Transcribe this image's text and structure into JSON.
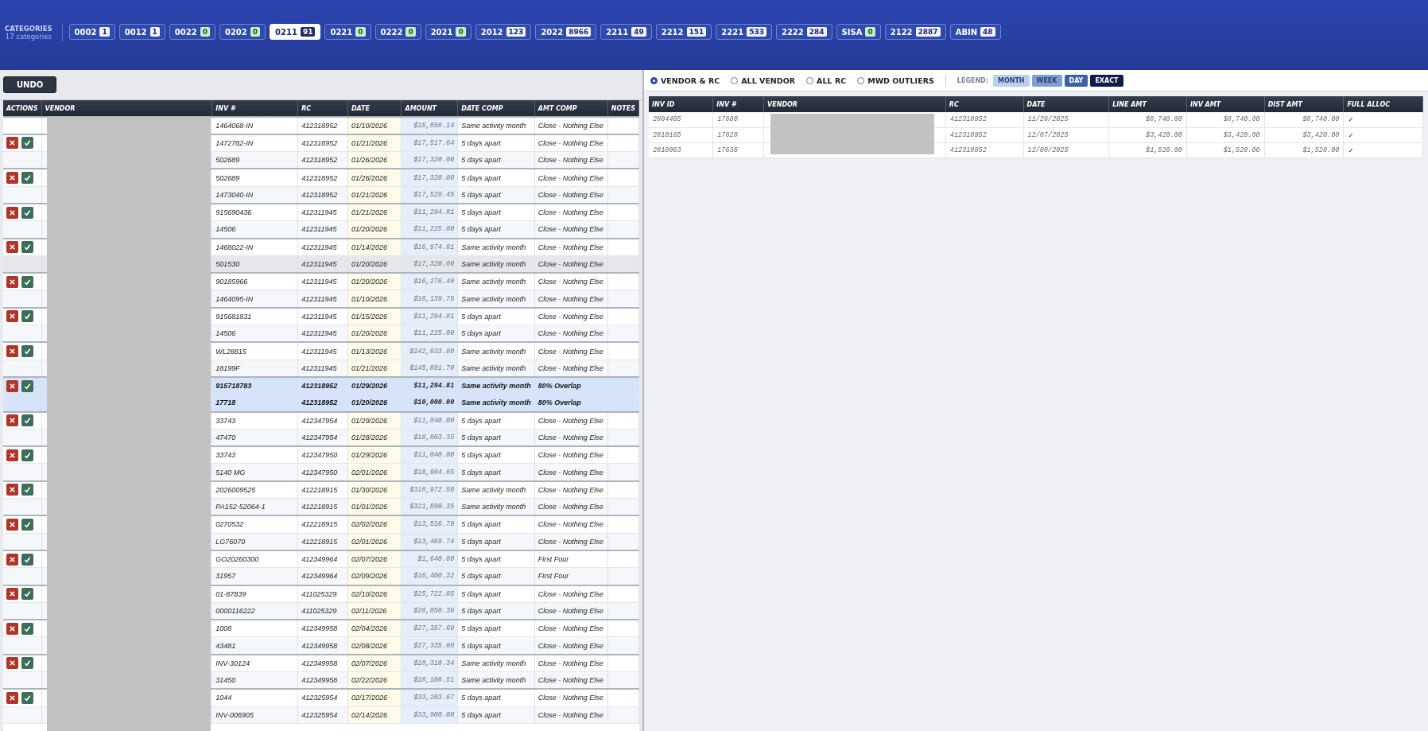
{
  "categories_panel": {
    "title": "CATEGORIES",
    "subtitle": "17 categories"
  },
  "categories": [
    {
      "code": "0002",
      "count": "1",
      "selected": false,
      "zero": false
    },
    {
      "code": "0012",
      "count": "1",
      "selected": false,
      "zero": false
    },
    {
      "code": "0022",
      "count": "0",
      "selected": false,
      "zero": true
    },
    {
      "code": "0202",
      "count": "0",
      "selected": false,
      "zero": true
    },
    {
      "code": "0211",
      "count": "91",
      "selected": true,
      "zero": false
    },
    {
      "code": "0221",
      "count": "0",
      "selected": false,
      "zero": true
    },
    {
      "code": "0222",
      "count": "0",
      "selected": false,
      "zero": true
    },
    {
      "code": "2021",
      "count": "0",
      "selected": false,
      "zero": true
    },
    {
      "code": "2012",
      "count": "123",
      "selected": false,
      "zero": false
    },
    {
      "code": "2022",
      "count": "8966",
      "selected": false,
      "zero": false
    },
    {
      "code": "2211",
      "count": "49",
      "selected": false,
      "zero": false
    },
    {
      "code": "2212",
      "count": "151",
      "selected": false,
      "zero": false
    },
    {
      "code": "2221",
      "count": "533",
      "selected": false,
      "zero": false
    },
    {
      "code": "2222",
      "count": "284",
      "selected": false,
      "zero": false
    },
    {
      "code": "SISA",
      "count": "0",
      "selected": false,
      "zero": true
    },
    {
      "code": "2122",
      "count": "2887",
      "selected": false,
      "zero": false
    },
    {
      "code": "ABIN",
      "count": "48",
      "selected": false,
      "zero": false
    }
  ],
  "undo_button": "UNDO",
  "match_table": {
    "columns": [
      "ACTIONS",
      "VENDOR",
      "INV #",
      "RC",
      "DATE",
      "AMOUNT",
      "DATE COMP",
      "AMT COMP",
      "NOTES"
    ],
    "pairs": [
      {
        "selected": false,
        "rows": [
          {
            "actions": false,
            "hovered": false,
            "inv": "1464068-IN",
            "rc": "412318952",
            "date": "01/10/2026",
            "amount": "$15,858.14",
            "date_comp": "Same activity month",
            "amt_comp": "Close - Nothing Else"
          }
        ]
      },
      {
        "selected": false,
        "rows": [
          {
            "actions": true,
            "hovered": false,
            "inv": "1472782-IN",
            "rc": "412318952",
            "date": "01/21/2026",
            "amount": "$17,517.64",
            "date_comp": "5 days apart",
            "amt_comp": "Close - Nothing Else"
          },
          {
            "actions": false,
            "hovered": false,
            "inv": "502689",
            "rc": "412318952",
            "date": "01/26/2026",
            "amount": "$17,320.00",
            "date_comp": "5 days apart",
            "amt_comp": "Close - Nothing Else"
          }
        ]
      },
      {
        "selected": false,
        "rows": [
          {
            "actions": true,
            "hovered": false,
            "inv": "502689",
            "rc": "412318952",
            "date": "01/26/2026",
            "amount": "$17,320.00",
            "date_comp": "5 days apart",
            "amt_comp": "Close - Nothing Else"
          },
          {
            "actions": false,
            "hovered": false,
            "inv": "1473040-IN",
            "rc": "412318952",
            "date": "01/21/2026",
            "amount": "$17,529.45",
            "date_comp": "5 days apart",
            "amt_comp": "Close - Nothing Else"
          }
        ]
      },
      {
        "selected": false,
        "rows": [
          {
            "actions": true,
            "hovered": false,
            "inv": "915690436",
            "rc": "412311945",
            "date": "01/21/2026",
            "amount": "$11,294.81",
            "date_comp": "5 days apart",
            "amt_comp": "Close - Nothing Else"
          },
          {
            "actions": false,
            "hovered": false,
            "inv": "14506",
            "rc": "412311945",
            "date": "01/20/2026",
            "amount": "$11,225.00",
            "date_comp": "5 days apart",
            "amt_comp": "Close - Nothing Else"
          }
        ]
      },
      {
        "selected": false,
        "rows": [
          {
            "actions": true,
            "hovered": false,
            "inv": "1468022-IN",
            "rc": "412311945",
            "date": "01/14/2026",
            "amount": "$16,974.81",
            "date_comp": "Same activity month",
            "amt_comp": "Close - Nothing Else"
          },
          {
            "actions": false,
            "hovered": true,
            "inv": "501530",
            "rc": "412311945",
            "date": "01/20/2026",
            "amount": "$17,320.00",
            "date_comp": "Same activity month",
            "amt_comp": "Close - Nothing Else"
          }
        ]
      },
      {
        "selected": false,
        "rows": [
          {
            "actions": true,
            "hovered": false,
            "inv": "90185966",
            "rc": "412311945",
            "date": "01/20/2026",
            "amount": "$16,276.40",
            "date_comp": "Same activity month",
            "amt_comp": "Close - Nothing Else"
          },
          {
            "actions": false,
            "hovered": false,
            "inv": "1464095-IN",
            "rc": "412311945",
            "date": "01/10/2026",
            "amount": "$16,139.76",
            "date_comp": "Same activity month",
            "amt_comp": "Close - Nothing Else"
          }
        ]
      },
      {
        "selected": false,
        "rows": [
          {
            "actions": true,
            "hovered": false,
            "inv": "915681831",
            "rc": "412311945",
            "date": "01/15/2026",
            "amount": "$11,294.81",
            "date_comp": "5 days apart",
            "amt_comp": "Close - Nothing Else"
          },
          {
            "actions": false,
            "hovered": false,
            "inv": "14506",
            "rc": "412311945",
            "date": "01/20/2026",
            "amount": "$11,225.00",
            "date_comp": "5 days apart",
            "amt_comp": "Close - Nothing Else"
          }
        ]
      },
      {
        "selected": false,
        "rows": [
          {
            "actions": true,
            "hovered": false,
            "inv": "WL28815",
            "rc": "412311945",
            "date": "01/13/2026",
            "amount": "$142,633.08",
            "date_comp": "Same activity month",
            "amt_comp": "Close - Nothing Else"
          },
          {
            "actions": false,
            "hovered": false,
            "inv": "18199F",
            "rc": "412311945",
            "date": "01/21/2026",
            "amount": "$145,891.70",
            "date_comp": "Same activity month",
            "amt_comp": "Close - Nothing Else"
          }
        ]
      },
      {
        "selected": true,
        "rows": [
          {
            "actions": true,
            "hovered": false,
            "inv": "915718783",
            "rc": "412318952",
            "date": "01/29/2026",
            "amount": "$11,294.81",
            "date_comp": "Same activity month",
            "amt_comp": "80% Overlap"
          },
          {
            "actions": false,
            "hovered": false,
            "inv": "17718",
            "rc": "412318952",
            "date": "01/20/2026",
            "amount": "$10,000.00",
            "date_comp": "Same activity month",
            "amt_comp": "80% Overlap"
          }
        ]
      },
      {
        "selected": false,
        "rows": [
          {
            "actions": true,
            "hovered": false,
            "inv": "33743",
            "rc": "412347954",
            "date": "01/29/2026",
            "amount": "$11,040.00",
            "date_comp": "5 days apart",
            "amt_comp": "Close - Nothing Else"
          },
          {
            "actions": false,
            "hovered": false,
            "inv": "47470",
            "rc": "412347954",
            "date": "01/28/2026",
            "amount": "$10,803.35",
            "date_comp": "5 days apart",
            "amt_comp": "Close - Nothing Else"
          }
        ]
      },
      {
        "selected": false,
        "rows": [
          {
            "actions": true,
            "hovered": false,
            "inv": "33743",
            "rc": "412347950",
            "date": "01/29/2026",
            "amount": "$11,040.00",
            "date_comp": "5 days apart",
            "amt_comp": "Close - Nothing Else"
          },
          {
            "actions": false,
            "hovered": false,
            "inv": "5140 MG",
            "rc": "412347950",
            "date": "02/01/2026",
            "amount": "$10,904.85",
            "date_comp": "5 days apart",
            "amt_comp": "Close - Nothing Else"
          }
        ]
      },
      {
        "selected": false,
        "rows": [
          {
            "actions": true,
            "hovered": false,
            "inv": "2026009525",
            "rc": "412218915",
            "date": "01/30/2026",
            "amount": "$318,972.50",
            "date_comp": "Same activity month",
            "amt_comp": "Close - Nothing Else"
          },
          {
            "actions": false,
            "hovered": false,
            "inv": "PA152-52064-1",
            "rc": "412218915",
            "date": "01/01/2026",
            "amount": "$321,890.35",
            "date_comp": "Same activity month",
            "amt_comp": "Close - Nothing Else"
          }
        ]
      },
      {
        "selected": false,
        "rows": [
          {
            "actions": true,
            "hovered": false,
            "inv": "0270532",
            "rc": "412218915",
            "date": "02/02/2026",
            "amount": "$13,516.79",
            "date_comp": "5 days apart",
            "amt_comp": "Close - Nothing Else"
          },
          {
            "actions": false,
            "hovered": false,
            "inv": "LG76070",
            "rc": "412218915",
            "date": "02/01/2026",
            "amount": "$13,469.74",
            "date_comp": "5 days apart",
            "amt_comp": "Close - Nothing Else"
          }
        ]
      },
      {
        "selected": false,
        "rows": [
          {
            "actions": true,
            "hovered": false,
            "inv": "GO20260300",
            "rc": "412349964",
            "date": "02/07/2026",
            "amount": "$1,640.00",
            "date_comp": "5 days apart",
            "amt_comp": "First Four"
          },
          {
            "actions": false,
            "hovered": false,
            "inv": "31957",
            "rc": "412349964",
            "date": "02/09/2026",
            "amount": "$16,400.32",
            "date_comp": "5 days apart",
            "amt_comp": "First Four"
          }
        ]
      },
      {
        "selected": false,
        "rows": [
          {
            "actions": true,
            "hovered": false,
            "inv": "01-87839",
            "rc": "411025329",
            "date": "02/10/2026",
            "amount": "$25,722.85",
            "date_comp": "5 days apart",
            "amt_comp": "Close - Nothing Else"
          },
          {
            "actions": false,
            "hovered": false,
            "inv": "0000116222",
            "rc": "411025329",
            "date": "02/11/2026",
            "amount": "$26,050.36",
            "date_comp": "5 days apart",
            "amt_comp": "Close - Nothing Else"
          }
        ]
      },
      {
        "selected": false,
        "rows": [
          {
            "actions": true,
            "hovered": false,
            "inv": "1008",
            "rc": "412349958",
            "date": "02/04/2026",
            "amount": "$27,357.69",
            "date_comp": "5 days apart",
            "amt_comp": "Close - Nothing Else"
          },
          {
            "actions": false,
            "hovered": false,
            "inv": "43481",
            "rc": "412349958",
            "date": "02/08/2026",
            "amount": "$27,335.00",
            "date_comp": "5 days apart",
            "amt_comp": "Close - Nothing Else"
          }
        ]
      },
      {
        "selected": false,
        "rows": [
          {
            "actions": true,
            "hovered": false,
            "inv": "INV-30124",
            "rc": "412349958",
            "date": "02/07/2026",
            "amount": "$18,318.34",
            "date_comp": "Same activity month",
            "amt_comp": "Close - Nothing Else"
          },
          {
            "actions": false,
            "hovered": false,
            "inv": "31450",
            "rc": "412349958",
            "date": "02/22/2026",
            "amount": "$18,106.51",
            "date_comp": "Same activity month",
            "amt_comp": "Close - Nothing Else"
          }
        ]
      },
      {
        "selected": false,
        "rows": [
          {
            "actions": true,
            "hovered": false,
            "inv": "1044",
            "rc": "412325954",
            "date": "02/17/2026",
            "amount": "$33,203.67",
            "date_comp": "5 days apart",
            "amt_comp": "Close - Nothing Else"
          },
          {
            "actions": false,
            "hovered": false,
            "inv": "INV-006905",
            "rc": "412325954",
            "date": "02/14/2026",
            "amount": "$33,900.00",
            "date_comp": "5 days apart",
            "amt_comp": "Close - Nothing Else"
          }
        ]
      }
    ]
  },
  "view_options": [
    {
      "label": "VENDOR & RC",
      "selected": true
    },
    {
      "label": "ALL VENDOR",
      "selected": false
    },
    {
      "label": "ALL RC",
      "selected": false
    },
    {
      "label": "MWD OUTLIERS",
      "selected": false
    }
  ],
  "legend": {
    "label": "LEGEND:",
    "items": [
      {
        "label": "MONTH",
        "color": "#b9d1ee"
      },
      {
        "label": "WEEK",
        "color": "#7f9fd2"
      },
      {
        "label": "DAY",
        "color": "#3c5fa6"
      },
      {
        "label": "EXACT",
        "color": "#0f1c48"
      }
    ]
  },
  "detail_table": {
    "columns": [
      "INV ID",
      "INV #",
      "VENDOR",
      "RC",
      "DATE",
      "LINE AMT",
      "INV AMT",
      "DIST AMT",
      "FULL ALLOC"
    ],
    "rows": [
      {
        "inv_id": "2804405",
        "inv_no": "17600",
        "rc": "412318952",
        "date": "11/26/2025",
        "line_amt": "$8,740.00",
        "inv_amt": "$8,740.00",
        "dist_amt": "$8,740.00",
        "full_alloc": "✓"
      },
      {
        "inv_id": "2810165",
        "inv_no": "17628",
        "rc": "412318952",
        "date": "12/07/2025",
        "line_amt": "$3,420.00",
        "inv_amt": "$3,420.00",
        "dist_amt": "$3,420.00",
        "full_alloc": "✓"
      },
      {
        "inv_id": "2810063",
        "inv_no": "17636",
        "rc": "412318952",
        "date": "12/08/2025",
        "line_amt": "$1,520.00",
        "inv_amt": "$1,520.00",
        "dist_amt": "$1,520.00",
        "full_alloc": "✓"
      }
    ]
  }
}
